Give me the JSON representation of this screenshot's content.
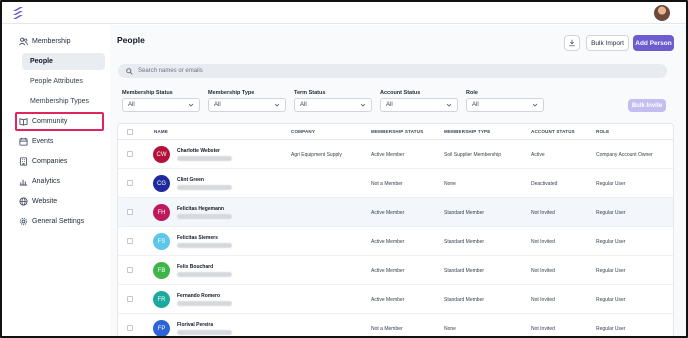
{
  "sidebar": {
    "section": "Membership",
    "sub_items": [
      "People",
      "People Attributes",
      "Membership Types"
    ],
    "items": [
      "Community",
      "Events",
      "Companies",
      "Analytics",
      "Website",
      "General Settings"
    ]
  },
  "page": {
    "title": "People",
    "bulk_import": "Bulk Import",
    "add_person": "Add Person",
    "search_placeholder": "Search names or emails",
    "bulk_invite": "Bulk Invite"
  },
  "filters": [
    {
      "label": "Membership Status",
      "value": "All"
    },
    {
      "label": "Membership Type",
      "value": "All"
    },
    {
      "label": "Term Status",
      "value": "All"
    },
    {
      "label": "Account Status",
      "value": "All"
    },
    {
      "label": "Role",
      "value": "All"
    }
  ],
  "table": {
    "headers": [
      "NAME",
      "COMPANY",
      "MEMBERSHIP STATUS",
      "MEMBERSHIP TYPE",
      "ACCOUNT STATUS",
      "ROLE"
    ],
    "rows": [
      {
        "initials": "CW",
        "color": "#b4123a",
        "name": "Charlotte Webster",
        "company": "Agri Equipment Supply",
        "mstatus": "Active Member",
        "mtype": "Soil Supplier Membership",
        "astatus": "Active",
        "role": "Company Account Owner"
      },
      {
        "initials": "CG",
        "color": "#1e2a9e",
        "name": "Clint Green",
        "company": "",
        "mstatus": "Not a Member",
        "mtype": "None",
        "astatus": "Deactivated",
        "role": "Regular User"
      },
      {
        "initials": "FH",
        "color": "#c0185c",
        "name": "Felicitas Hegemann",
        "company": "",
        "mstatus": "Active Member",
        "mtype": "Standard Member",
        "astatus": "Not Invited",
        "role": "Regular User"
      },
      {
        "initials": "FS",
        "color": "#5cc7ea",
        "name": "Felicitas Siemers",
        "company": "",
        "mstatus": "Active Member",
        "mtype": "Standard Member",
        "astatus": "Not Invited",
        "role": "Regular User"
      },
      {
        "initials": "FB",
        "color": "#3fb548",
        "name": "Felix Bouchard",
        "company": "",
        "mstatus": "Active Member",
        "mtype": "Standard Member",
        "astatus": "Not Invited",
        "role": "Regular User"
      },
      {
        "initials": "FR",
        "color": "#1ca9a0",
        "name": "Fernando Romero",
        "company": "",
        "mstatus": "Active Member",
        "mtype": "Standard Member",
        "astatus": "Not Invited",
        "role": "Regular User"
      },
      {
        "initials": "FP",
        "color": "#2c63d6",
        "name": "Florival Pereira",
        "company": "",
        "mstatus": "Not a Member",
        "mtype": "None",
        "astatus": "Not Invited",
        "role": "Regular User"
      }
    ]
  }
}
